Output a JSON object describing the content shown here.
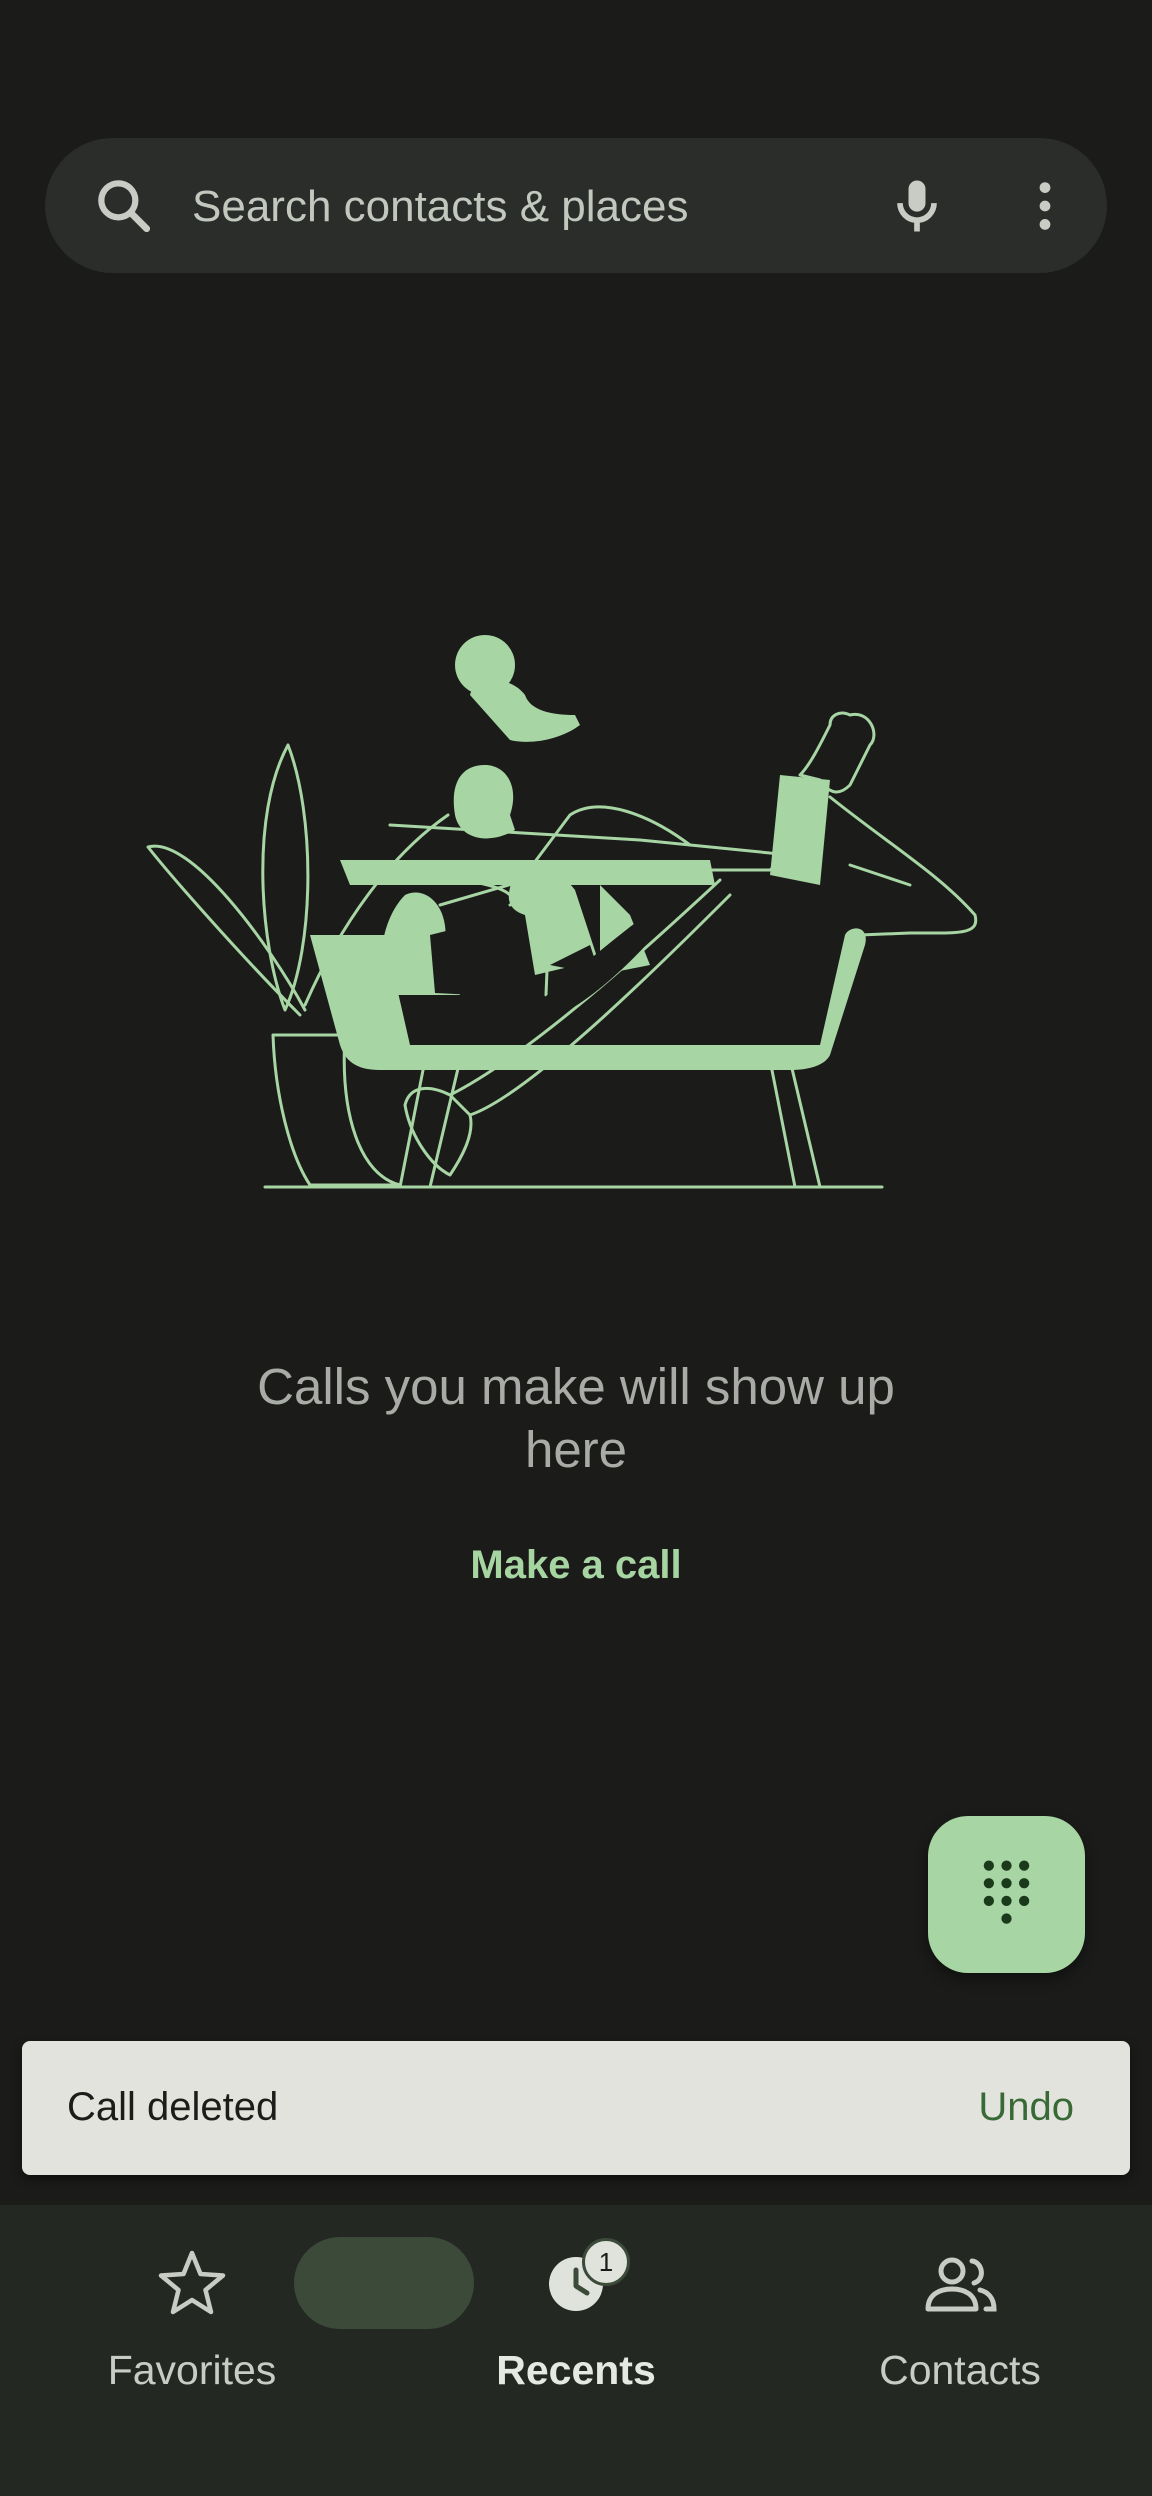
{
  "search": {
    "placeholder": "Search contacts & places",
    "search_icon": "search-icon",
    "mic_icon": "mic-icon",
    "more_icon": "more-vert-icon"
  },
  "empty_state": {
    "message": "Calls you make will show up here",
    "action_label": "Make a call"
  },
  "fab": {
    "icon": "dialpad-icon"
  },
  "snackbar": {
    "message": "Call deleted",
    "action": "Undo"
  },
  "bottom_nav": {
    "items": [
      {
        "label": "Favorites",
        "icon": "star-icon"
      },
      {
        "label": "Recents",
        "icon": "clock-icon",
        "badge": "1"
      },
      {
        "label": "Contacts",
        "icon": "people-icon"
      }
    ]
  },
  "colors": {
    "background": "#1b1c1a",
    "accent": "#a8d5a4",
    "accent_text": "#a7d5a2",
    "snackbar_bg": "#e3e3de",
    "snackbar_action": "#386a36",
    "nav_bg": "#242823",
    "active_pill": "#3c4a3a"
  }
}
